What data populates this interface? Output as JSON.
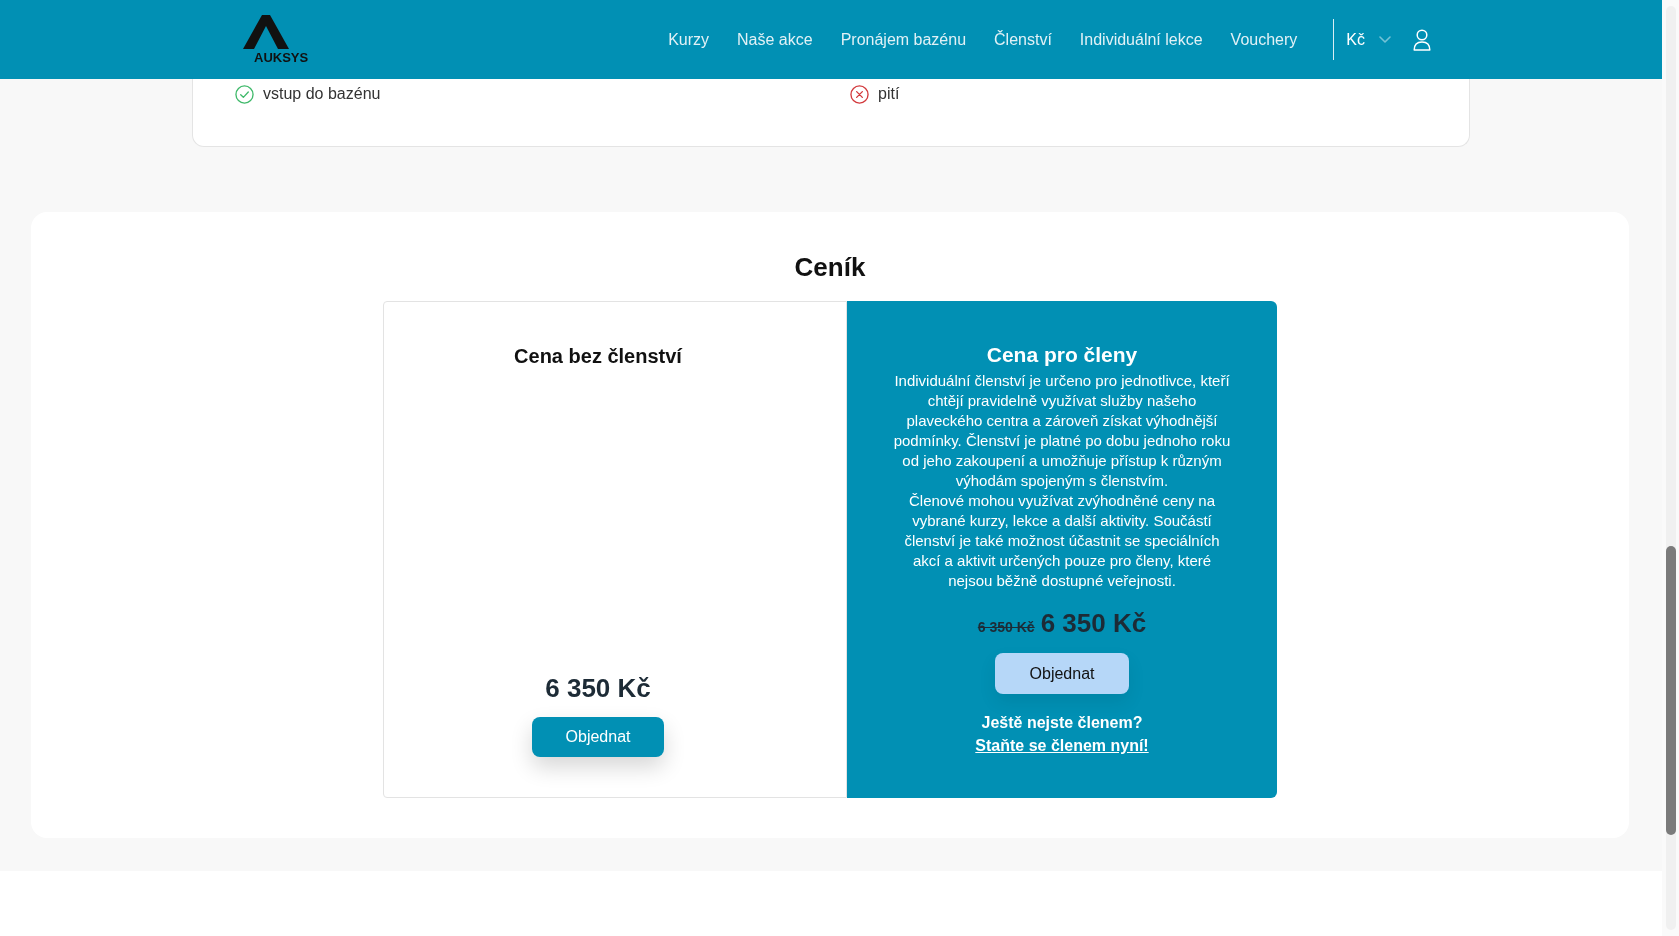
{
  "header": {
    "logo": "AUKSYS",
    "nav_links": [
      "Kurzy",
      "Naše akce",
      "Pronájem bazénu",
      "Členství",
      "Individuální lekce",
      "Vouchery"
    ],
    "currency": "Kč"
  },
  "features": [
    {
      "label": "vstup do bazénu",
      "included": true
    },
    {
      "label": "pití",
      "included": false
    }
  ],
  "pricing": {
    "title": "Ceník",
    "plans": [
      {
        "kind": "standard",
        "title": "Cena bez členství",
        "price": "6 350 Kč",
        "button": "Objednat"
      },
      {
        "kind": "member",
        "title": "Cena pro členy",
        "description": [
          "Individuální členství je určeno pro jednotlivce, kteří chtějí pravidelně využívat služby našeho plaveckého centra a zároveň získat výhodnější podmínky. Členství je platné po dobu jednoho roku od jeho zakoupení a umožňuje přístup k různým výhodám spojeným s členstvím.",
          "Členové mohou využívat zvýhodněné ceny na vybrané kurzy, lekce a další aktivity. Součástí členství je také možnost účastnit se speciálních akcí a aktivit určených pouze pro členy, které nejsou běžně dostupné veřejnosti."
        ],
        "old_price": "6 350 Kč",
        "price": "6 350 Kč",
        "button": "Objednat",
        "prompt": "Ještě nejste členem?",
        "link": "Staňte se členem nyní!"
      }
    ]
  }
}
